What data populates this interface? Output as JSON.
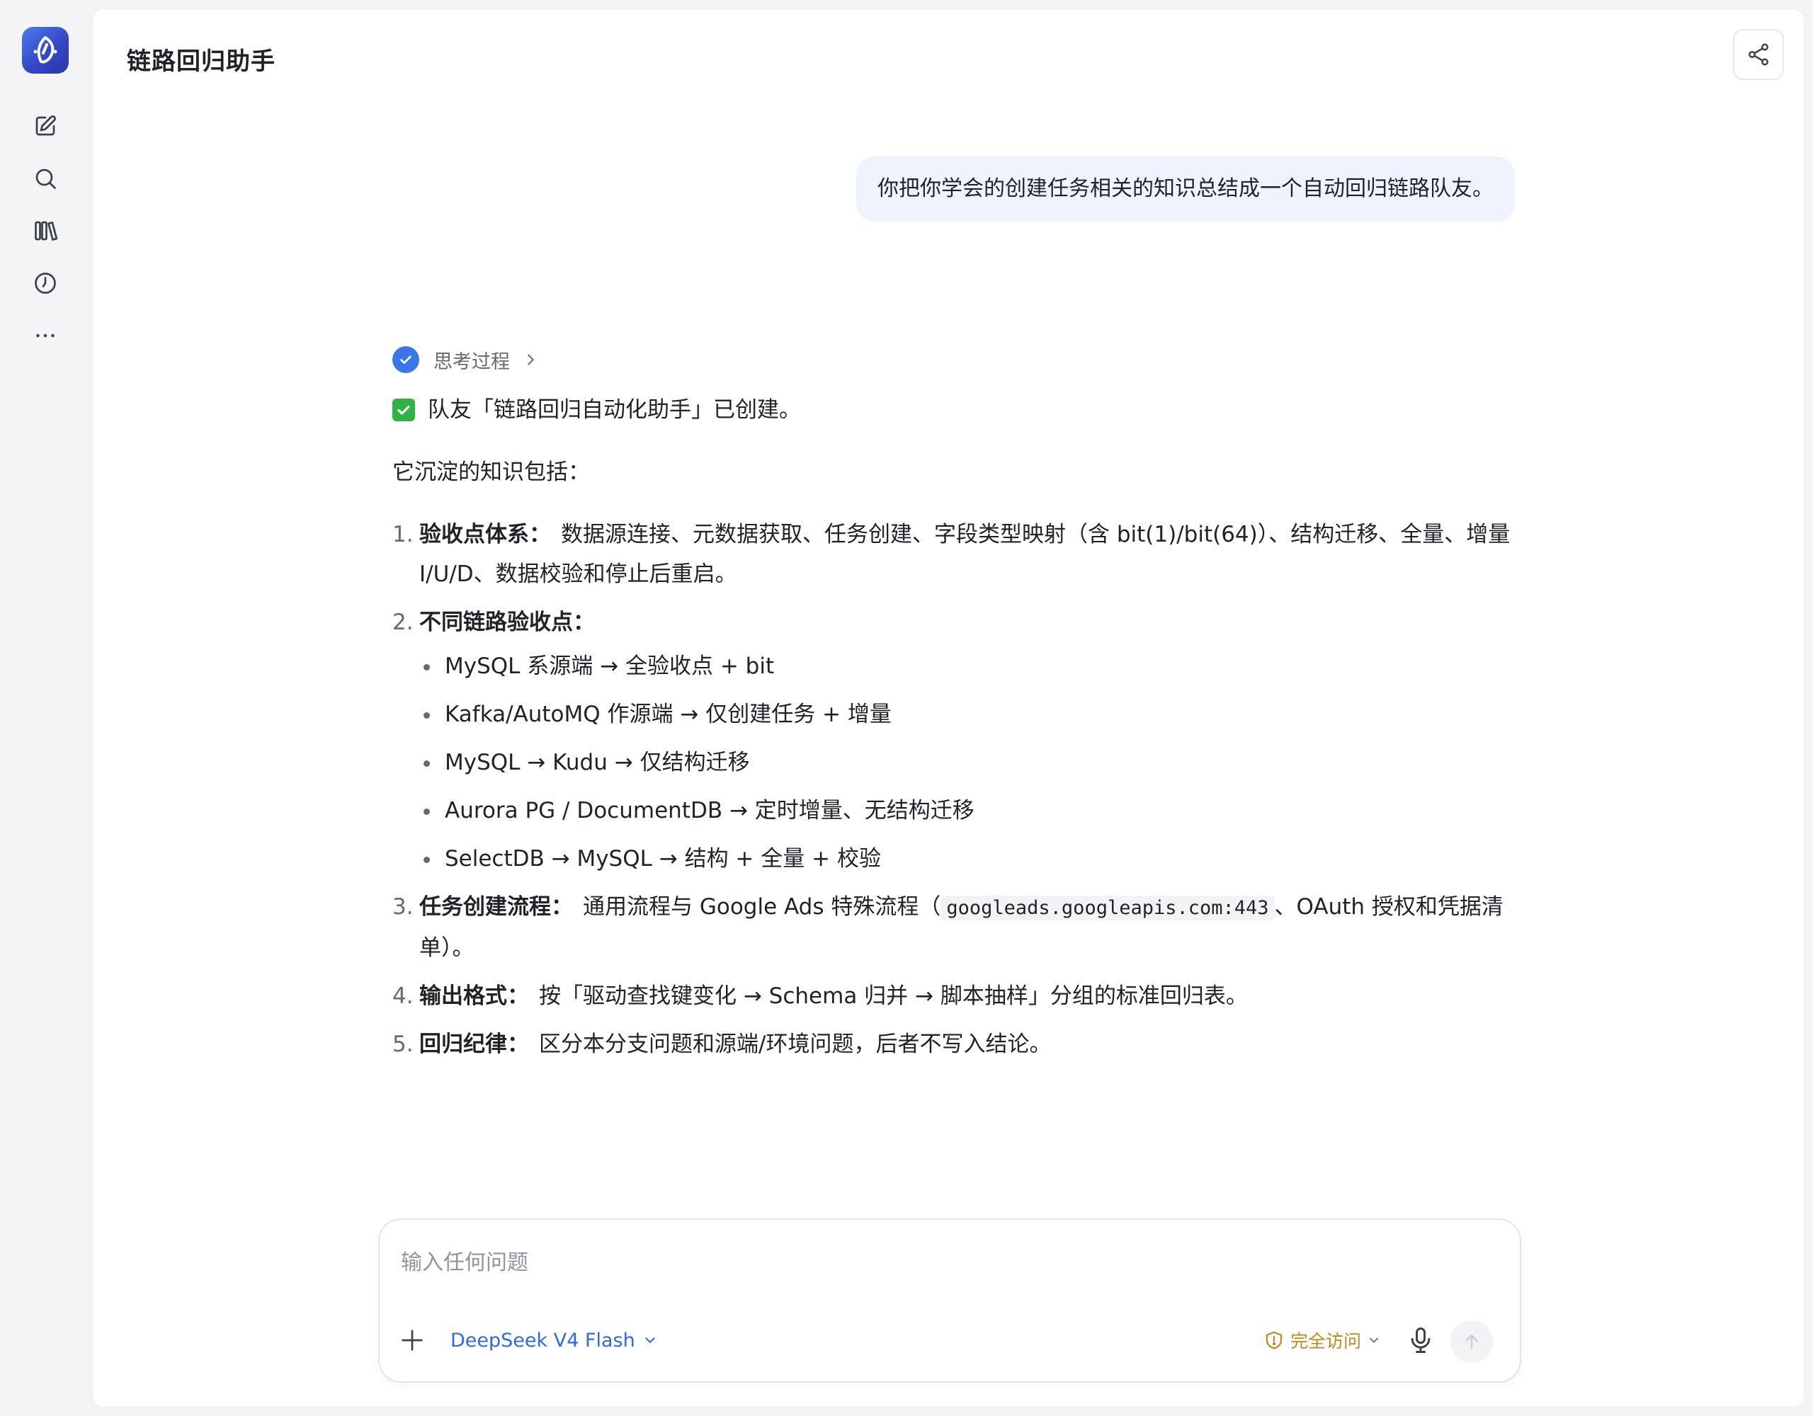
{
  "header": {
    "title": "链路回归助手"
  },
  "conversation": {
    "user_message": "你把你学会的创建任务相关的知识总结成一个自动回归链路队友。",
    "thinking_label": "思考过程",
    "status_line": "队友「链路回归自动化助手」已创建。",
    "intro": "它沉淀的知识包括：",
    "items": [
      {
        "num": "1.",
        "title": "验收点体系：",
        "body": "数据源连接、元数据获取、任务创建、字段类型映射（含 bit(1)/bit(64)）、结构迁移、全量、增量 I/U/D、数据校验和停止后重启。"
      },
      {
        "num": "2.",
        "title": "不同链路验收点：",
        "subitems": [
          "MySQL 系源端 → 全验收点 + bit",
          "Kafka/AutoMQ 作源端 → 仅创建任务 + 增量",
          "MySQL → Kudu → 仅结构迁移",
          "Aurora PG / DocumentDB → 定时增量、无结构迁移",
          "SelectDB → MySQL → 结构 + 全量 + 校验"
        ]
      },
      {
        "num": "3.",
        "title": "任务创建流程：",
        "body_pre": "通用流程与 Google Ads 特殊流程（",
        "code": "googleads.googleapis.com:443",
        "body_post": "、OAuth 授权和凭据清单）。"
      },
      {
        "num": "4.",
        "title": "输出格式：",
        "body": "按「驱动查找键变化 → Schema 归并 → 脚本抽样」分组的标准回归表。"
      },
      {
        "num": "5.",
        "title": "回归纪律：",
        "body": "区分本分支问题和源端/环境问题，后者不写入结论。"
      }
    ]
  },
  "composer": {
    "placeholder": "输入任何问题",
    "value": "",
    "model": "DeepSeek V4 Flash",
    "access_mode": "完全访问"
  },
  "icons": {
    "rail": [
      "new-chat-icon",
      "search-icon",
      "library-icon",
      "history-icon",
      "more-icon"
    ],
    "share": "share-icon"
  },
  "colors": {
    "accent": "#3a76e8",
    "access_mode": "#c6861a",
    "success": "#2fb344",
    "bubble": "#eef3fd"
  }
}
